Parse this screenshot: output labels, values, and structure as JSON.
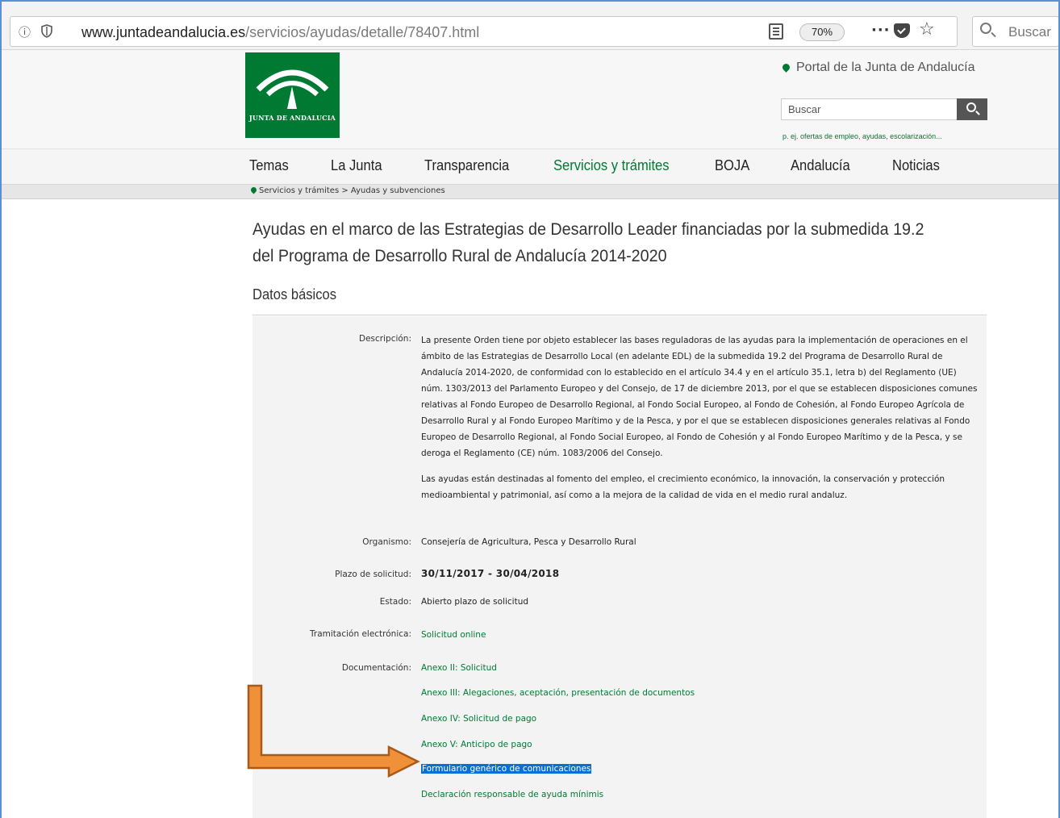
{
  "browser": {
    "url_host": "www.juntadeandalucia.es",
    "url_path": "/servicios/ayudas/detalle/78407.html",
    "zoom": "70%",
    "dots": "···",
    "search_placeholder": "Buscar"
  },
  "header": {
    "logo_text": "JUNTA DE ANDALUCIA",
    "portal_link": "Portal de la Junta de Andalucía",
    "search_value": "Buscar",
    "search_hint": "p. ej. ofertas de empleo, ayudas, escolarización..."
  },
  "nav": {
    "items": [
      "Temas",
      "La Junta",
      "Transparencia",
      "Servicios y trámites",
      "BOJA",
      "Andalucía",
      "Noticias"
    ],
    "active": "Servicios y trámites"
  },
  "breadcrumb": {
    "item1": "Servicios y trámites",
    "separator": ">",
    "item2": "Ayudas y subvenciones"
  },
  "page": {
    "title": "Ayudas en el marco de las Estrategias de Desarrollo Leader financiadas por la submedida 19.2 del Programa de Desarrollo Rural de Andalucía 2014-2020",
    "section": "Datos básicos"
  },
  "details": {
    "descripcion_label": "Descripción:",
    "descripcion_p1": "La presente Orden tiene por objeto establecer las bases reguladoras de las ayudas para la implementación de operaciones en el ámbito de las Estrategias de Desarrollo Local (en adelante EDL) de la submedida 19.2 del Programa de Desarrollo Rural de Andalucía 2014-2020, de conformidad con lo establecido en el artículo 34.4 y en el artículo 35.1, letra b) del Reglamento (UE) núm. 1303/2013 del Parlamento Europeo y del Consejo, de 17 de diciembre 2013, por el que se establecen disposiciones comunes relativas al Fondo Europeo de Desarrollo Regional, al Fondo Social Europeo, al Fondo de Cohesión, al Fondo Europeo Agrícola de Desarrollo Rural y al Fondo Europeo Marítimo y de la Pesca, y por el que se establecen disposiciones generales relativas al Fondo Europeo de Desarrollo Regional, al Fondo Social Europeo, al Fondo de Cohesión y al Fondo Europeo Marítimo y de la Pesca, y se deroga el Reglamento (CE) núm. 1083/2006 del Consejo.",
    "descripcion_p2": "Las ayudas están destinadas al fomento del empleo, el crecimiento económico, la innovación, la conservación y protección medioambiental y patrimonial, así como a la mejora de la calidad de vida en el medio rural andaluz.",
    "organismo_label": "Organismo:",
    "organismo_value": "Consejería de Agricultura, Pesca y Desarrollo Rural",
    "plazo_label": "Plazo de solicitud:",
    "plazo_value": "30/11/2017 - 30/04/2018",
    "estado_label": "Estado:",
    "estado_value": "Abierto plazo de solicitud",
    "tramitacion_label": "Tramitación electrónica:",
    "tramitacion_value": "Solicitud online",
    "documentacion_label": "Documentación:",
    "docs": [
      "Anexo II: Solicitud",
      "Anexo III: Alegaciones, aceptación, presentación de documentos",
      "Anexo IV: Solicitud de pago",
      "Anexo V: Anticipo de pago",
      "Formulario genérico de comunicaciones",
      "Declaración responsable de ayuda mínimis"
    ]
  },
  "colors": {
    "brand_green": "#007a33",
    "selection": "#0a6fd4",
    "arrow_orange": "#f0913a"
  }
}
